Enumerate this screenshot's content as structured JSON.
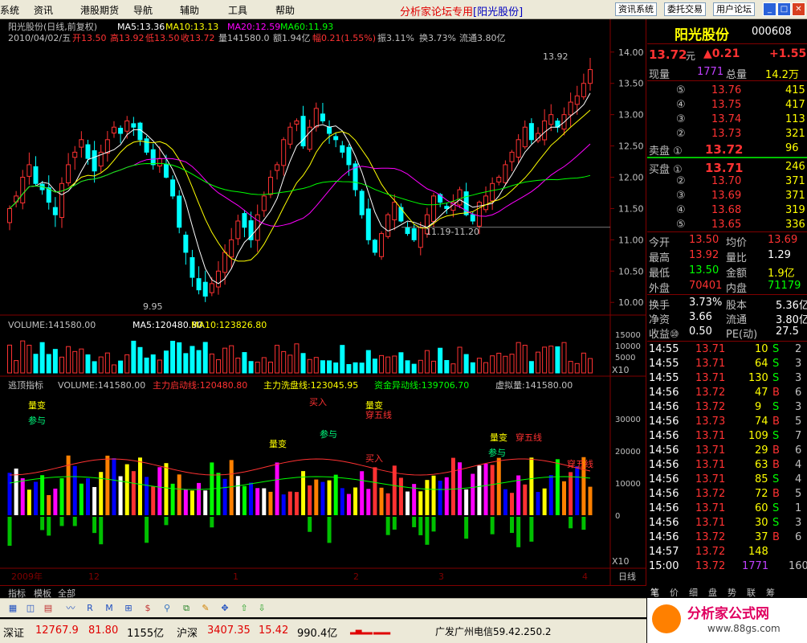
{
  "menu": {
    "items": [
      "系统",
      "资讯",
      "港股期货",
      "导航",
      "辅助",
      "工具",
      "帮助"
    ],
    "title": "分析家论坛专用",
    "title_stock": "[阳光股份]",
    "buttons": [
      "资讯系统",
      "委托交易",
      "用户论坛"
    ]
  },
  "chart": {
    "header1": "阳光股份(日线,前复权)",
    "ma5": "MA5:13.36",
    "ma10": "MA10:13.13",
    "ma20": "MA20:12.59",
    "ma60": "MA60:11.93",
    "header2_date": "2010/04/02/五",
    "open": "开13.50",
    "high": "高13.92",
    "low": "低13.50",
    "close": "收13.72",
    "vol": "量141580.0",
    "amount": "额1.94亿",
    "change": "幅0.21(1.55%)",
    "amp": "振3.11%",
    "turn": "换3.73%",
    "float": "流通3.80亿",
    "price_ticks": [
      "14.00",
      "13.50",
      "13.00",
      "12.50",
      "12.00",
      "11.50",
      "11.00",
      "10.50",
      "10.00"
    ],
    "annotation_high": "13.92",
    "annotation_low": "9.95",
    "annotation_range": "11.19-11.20",
    "vol_header": "VOLUME:141580.00",
    "vol_ma5": "MA5:120480.80",
    "vol_ma10": "MA10:123826.80",
    "vol_ticks": [
      "15000",
      "10000",
      "5000"
    ],
    "vol_unit": "X10",
    "ind_name": "逃顶指标",
    "ind_vol": "VOLUME:141580.00",
    "ind_l1": "主力启动线:120480.80",
    "ind_l2": "主力洗盘线:123045.95",
    "ind_l3": "资金异动线:139706.70",
    "ind_l4": "虚拟量:141580.00",
    "ind_ticks": [
      "30000",
      "20000",
      "10000",
      "0"
    ],
    "ind_unit": "X10",
    "sig_liangbian": "量变",
    "sig_canyu": "参与",
    "sig_mairu": "买入",
    "sig_yuxian": "穿五线",
    "axis_labels": [
      "2009年",
      "12",
      "1",
      "2",
      "3",
      "4"
    ],
    "period": "日线"
  },
  "chart_data": {
    "type": "candlestick",
    "title": "阳光股份(日线,前复权)",
    "date": "2010/04/02",
    "ohlc_last": {
      "open": 13.5,
      "high": 13.92,
      "low": 13.5,
      "close": 13.72
    },
    "closes": [
      11.5,
      11.7,
      12.0,
      12.2,
      11.9,
      11.8,
      11.6,
      11.4,
      11.9,
      12.2,
      12.4,
      12.6,
      12.3,
      12.1,
      12.4,
      12.6,
      12.8,
      12.7,
      12.9,
      12.8,
      12.6,
      12.4,
      12.2,
      12.3,
      12.0,
      11.7,
      11.2,
      10.8,
      10.4,
      10.2,
      10.1,
      10.3,
      10.5,
      10.8,
      11.0,
      11.3,
      11.2,
      11.0,
      11.4,
      11.7,
      12.0,
      12.2,
      12.6,
      12.8,
      12.9,
      12.5,
      12.8,
      13.1,
      12.9,
      12.7,
      12.6,
      12.4,
      12.2,
      11.8,
      11.4,
      11.0,
      10.8,
      11.1,
      11.4,
      11.6,
      11.3,
      11.1,
      11.0,
      11.2,
      11.4,
      11.7,
      11.6,
      11.5,
      11.6,
      11.8,
      11.4,
      11.3,
      11.6,
      11.7,
      11.9,
      12.0,
      12.2,
      12.4,
      12.6,
      12.8,
      12.6,
      12.7,
      12.9,
      13.0,
      12.8,
      13.0,
      13.2,
      13.3,
      13.5,
      13.72
    ],
    "price_range": [
      9.9,
      14.1
    ],
    "volume_last": 141580,
    "vol_ma5": 120480.8,
    "vol_ma10": 123826.8
  },
  "quote": {
    "name": "阳光股份",
    "code": "000608",
    "price": "13.72",
    "price_unit": "元",
    "change": "▲0.21",
    "pct": "+1.55",
    "xl_label": "现量",
    "xl": "1771",
    "zl_label": "总量",
    "zl": "14.2万",
    "sell": [
      {
        "n": "⑤",
        "p": "13.76",
        "v": "415"
      },
      {
        "n": "④",
        "p": "13.75",
        "v": "417"
      },
      {
        "n": "③",
        "p": "13.74",
        "v": "113"
      },
      {
        "n": "②",
        "p": "13.73",
        "v": "321"
      },
      {
        "n": "卖盘 ①",
        "p": "13.72",
        "v": "96"
      }
    ],
    "buy": [
      {
        "n": "买盘 ①",
        "p": "13.71",
        "v": "246"
      },
      {
        "n": "②",
        "p": "13.70",
        "v": "371"
      },
      {
        "n": "③",
        "p": "13.69",
        "v": "371"
      },
      {
        "n": "④",
        "p": "13.68",
        "v": "319"
      },
      {
        "n": "⑤",
        "p": "13.65",
        "v": "336"
      }
    ],
    "stats": [
      [
        "今开",
        "13.50",
        "均价",
        "13.69"
      ],
      [
        "最高",
        "13.92",
        "量比",
        "1.29"
      ],
      [
        "最低",
        "13.50",
        "金额",
        "1.9亿"
      ],
      [
        "外盘",
        "70401",
        "内盘",
        "71179"
      ]
    ],
    "fund": [
      [
        "换手",
        "3.73%",
        "股本",
        "5.36亿"
      ],
      [
        "净资",
        "3.66",
        "流通",
        "3.80亿"
      ],
      [
        "收益⑩",
        "0.50",
        "PE(动)",
        "27.5"
      ]
    ],
    "ticks": [
      [
        "14:55",
        "13.71",
        "10",
        "S",
        "2"
      ],
      [
        "14:55",
        "13.71",
        "64",
        "S",
        "3"
      ],
      [
        "14:55",
        "13.71",
        "130",
        "S",
        "3"
      ],
      [
        "14:56",
        "13.72",
        "47",
        "B",
        "6"
      ],
      [
        "14:56",
        "13.72",
        "9",
        "S",
        "3"
      ],
      [
        "14:56",
        "13.73",
        "74",
        "B",
        "5"
      ],
      [
        "14:56",
        "13.71",
        "109",
        "S",
        "7"
      ],
      [
        "14:56",
        "13.71",
        "29",
        "B",
        "6"
      ],
      [
        "14:56",
        "13.71",
        "63",
        "B",
        "4"
      ],
      [
        "14:56",
        "13.71",
        "85",
        "S",
        "4"
      ],
      [
        "14:56",
        "13.72",
        "72",
        "B",
        "5"
      ],
      [
        "14:56",
        "13.71",
        "60",
        "S",
        "1"
      ],
      [
        "14:56",
        "13.71",
        "30",
        "S",
        "3"
      ],
      [
        "14:56",
        "13.72",
        "37",
        "B",
        "6"
      ],
      [
        "14:57",
        "13.72",
        "148",
        "",
        ""
      ],
      [
        "15:00",
        "13.72",
        "1771",
        "",
        "160"
      ]
    ]
  },
  "tabs": {
    "left": [
      "指标",
      "模板",
      "全部"
    ],
    "right": [
      "笔",
      "价",
      "细",
      "盘",
      "势",
      "联",
      "筹"
    ]
  },
  "status": {
    "sz_label": "深证",
    "sz": "12767.9",
    "sz_chg": "81.80",
    "sz_amt": "1155亿",
    "hs_label": "沪深",
    "hs": "3407.35",
    "hs_chg": "15.42",
    "hs_amt": "990.4亿",
    "server": "广发广州电信59.42.250.2"
  },
  "logo": {
    "text": "分析家公式网",
    "url": "www.88gs.com"
  },
  "colors": {
    "up": "#ff3232",
    "down": "#00ffff",
    "ma5": "#ffffff",
    "ma10": "#ffff00",
    "ma20": "#ff00ff",
    "ma60": "#00ff00",
    "axis": "#800000"
  }
}
